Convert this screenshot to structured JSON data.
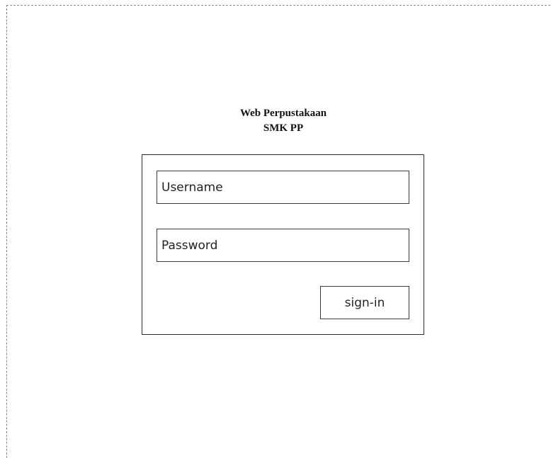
{
  "header": {
    "title_line1": "Web Perpustakaan",
    "title_line2": "SMK PP"
  },
  "login_form": {
    "username_placeholder": "Username",
    "password_placeholder": "Password",
    "sign_in_label": "sign-in"
  }
}
